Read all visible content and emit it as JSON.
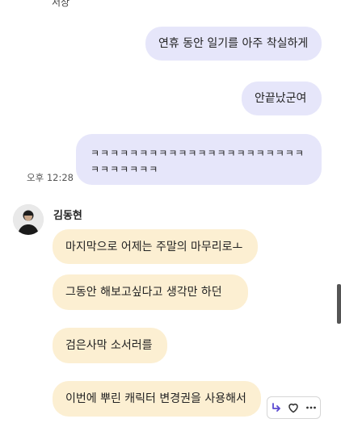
{
  "header": {
    "partial_label": "서상"
  },
  "messages": {
    "m1": "연휴 동안 일기를 아주 착실하게",
    "m2": "안끝났군여",
    "m3": "ㅋㅋㅋㅋㅋㅋㅋㅋㅋㅋㅋㅋㅋㅋㅋㅋㅋㅋㅋㅋㅋㅋㅋㅋㅋㅋㅋㅋㅋ",
    "m3_time": "오후 12:28",
    "sender_name": "김동현",
    "r1": "마지막으로 어제는 주말의 마무리로ㅗ",
    "r2": "그동안 해보고싶다고 생각만 하던",
    "r3": "검은사막 소서러를",
    "r4": "이번에 뿌린 캐릭터 변경권을 사용해서"
  },
  "actions": {
    "reply_icon": "reply-arrow-icon",
    "like_icon": "heart-icon",
    "more_icon": "more-dots-icon"
  },
  "colors": {
    "sent_bubble": "#e6e6fa",
    "received_bubble": "#fcefd2",
    "reply_accent": "#5b4ad1"
  }
}
